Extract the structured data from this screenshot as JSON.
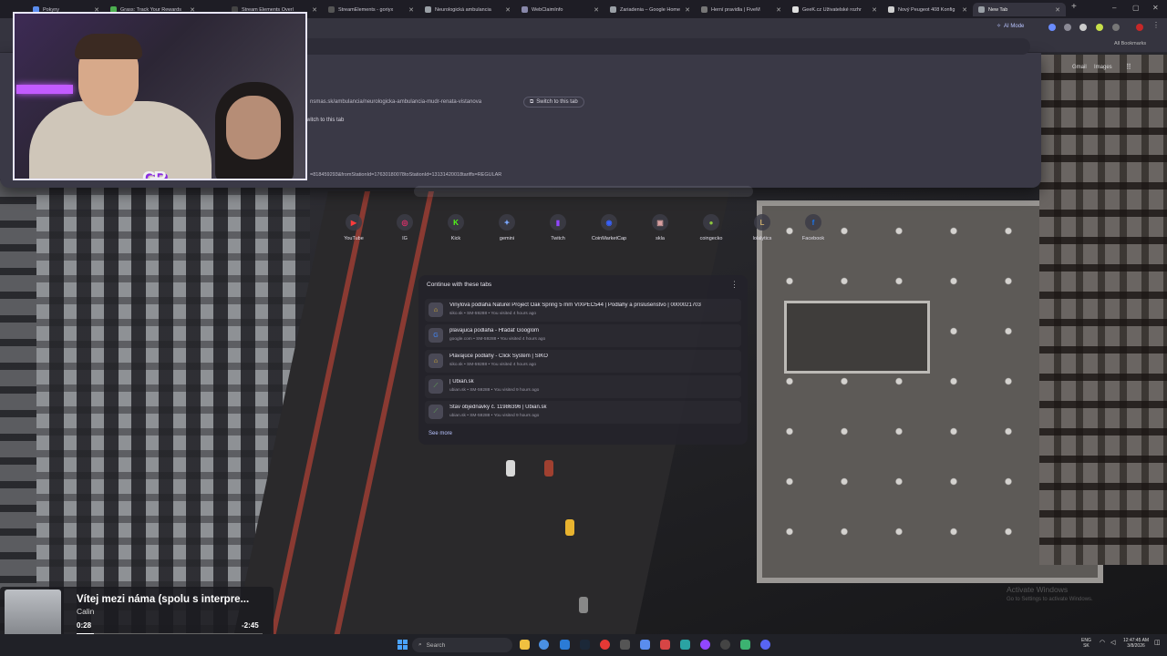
{
  "browser": {
    "tabs": [
      {
        "label": "Pokyny",
        "color": "#5b8def",
        "active": false
      },
      {
        "label": "Grass: Track Your Rewards",
        "color": "#4caf50",
        "active": false
      },
      {
        "label": "Stream Elements Overl",
        "color": "#444",
        "active": false
      },
      {
        "label": "StreamElements - goriyx",
        "color": "#555",
        "active": false
      },
      {
        "label": "Neurologická ambulancia",
        "color": "#9aa0a6",
        "active": false
      },
      {
        "label": "WebClaimInfo",
        "color": "#8888aa",
        "active": false
      },
      {
        "label": "Zariadenia – Google Home",
        "color": "#9aa0a6",
        "active": false
      },
      {
        "label": "Herní pravidla | FiveM",
        "color": "#777",
        "active": false
      },
      {
        "label": "GeeK.cz Uživatelské rozhr",
        "color": "#e0e0e0",
        "active": false
      },
      {
        "label": "Nový Peugeot 408 Konfig",
        "color": "#cfcfcf",
        "active": false
      },
      {
        "label": "New Tab",
        "color": "#9aa0a6",
        "active": true
      }
    ],
    "ai_mode_label": "AI Mode",
    "all_bookmarks": "All Bookmarks",
    "suggestions": [
      {
        "text": "nsmas.sk/ambulancia/neurologicka-ambulancia-mudr-renata-vistanova",
        "button": "Switch to this tab"
      },
      {
        "text": "",
        "button": "Switch to this tab"
      },
      {
        "text": "=818459293&fromStationId=17630180078toStationId=13131420018tariffs=REGULAR",
        "button": ""
      }
    ]
  },
  "ntp": {
    "top_right": [
      "Gmail",
      "Images"
    ],
    "shortcuts": [
      {
        "label": "YouTube",
        "icon": "youtube-icon",
        "color": "#ff3b3b",
        "glyph": "▶"
      },
      {
        "label": "IG",
        "icon": "instagram-icon",
        "color": "#e1306c",
        "glyph": "◎"
      },
      {
        "label": "Kick",
        "icon": "kick-icon",
        "color": "#53fc18",
        "glyph": "K"
      },
      {
        "label": "gemini",
        "icon": "gemini-icon",
        "color": "#7aa7ff",
        "glyph": "✦"
      },
      {
        "label": "Twitch",
        "icon": "twitch-icon",
        "color": "#9146ff",
        "glyph": "▮"
      },
      {
        "label": "CoinMarketCap",
        "icon": "coinmarketcap-icon",
        "color": "#3861fb",
        "glyph": "◉"
      },
      {
        "label": "skla",
        "icon": "skla-icon",
        "color": "#d9a0a0",
        "glyph": "▣"
      },
      {
        "label": "coingecko",
        "icon": "coingecko-icon",
        "color": "#8dc63f",
        "glyph": "●"
      },
      {
        "label": "lolalytics",
        "icon": "lolalytics-icon",
        "color": "#c8a96b",
        "glyph": "L"
      },
      {
        "label": "Facebook",
        "icon": "facebook-icon",
        "color": "#1877f2",
        "glyph": "f"
      }
    ],
    "continue": {
      "header": "Continue with these tabs",
      "rows": [
        {
          "title": "Vinylová podlaha Naturel Project Oak Spring 5 mm VIXPEC544 | Podlahy a príslušenstvo | 0000021703",
          "sub": "siko.sk • SM-59288 • You visited 4 hours ago",
          "icon": "siko-icon",
          "glyph": "⌂",
          "color": "#f6c22b"
        },
        {
          "title": "plavajuca podlaha - Hľadať Googlom",
          "sub": "google.com • SM-59288 • You visited 4 hours ago",
          "icon": "google-icon",
          "glyph": "G",
          "color": "#4285f4"
        },
        {
          "title": "Plávajúce podlahy - Click Systém | SIKO",
          "sub": "siko.sk • SM-59288 • You visited 4 hours ago",
          "icon": "siko-icon",
          "glyph": "⌂",
          "color": "#f6c22b"
        },
        {
          "title": "| Ubian.sk",
          "sub": "ubian.sk • SM-59288 • You visited 9 hours ago",
          "icon": "ubian-icon",
          "glyph": "⟋",
          "color": "#6bbf59"
        },
        {
          "title": "Stav objednávky č. 11986396 | Ubian.sk",
          "sub": "ubian.sk • SM-59288 • You visited 9 hours ago",
          "icon": "ubian-icon",
          "glyph": "⟋",
          "color": "#6bbf59"
        }
      ],
      "see_more": "See more"
    }
  },
  "media": {
    "title": "Vítej mezi náma (spolu s interpre...",
    "artist": "Calin",
    "current": "0:28",
    "remaining": "-2:45",
    "progress": 0.093
  },
  "taskbar": {
    "search_placeholder": "Search",
    "lang": [
      "ENG",
      "SK"
    ],
    "time": "12:47:45 AM",
    "date": "3/8/2026"
  },
  "watermark": [
    "Activate Windows",
    "Go to Settings to activate Windows."
  ]
}
